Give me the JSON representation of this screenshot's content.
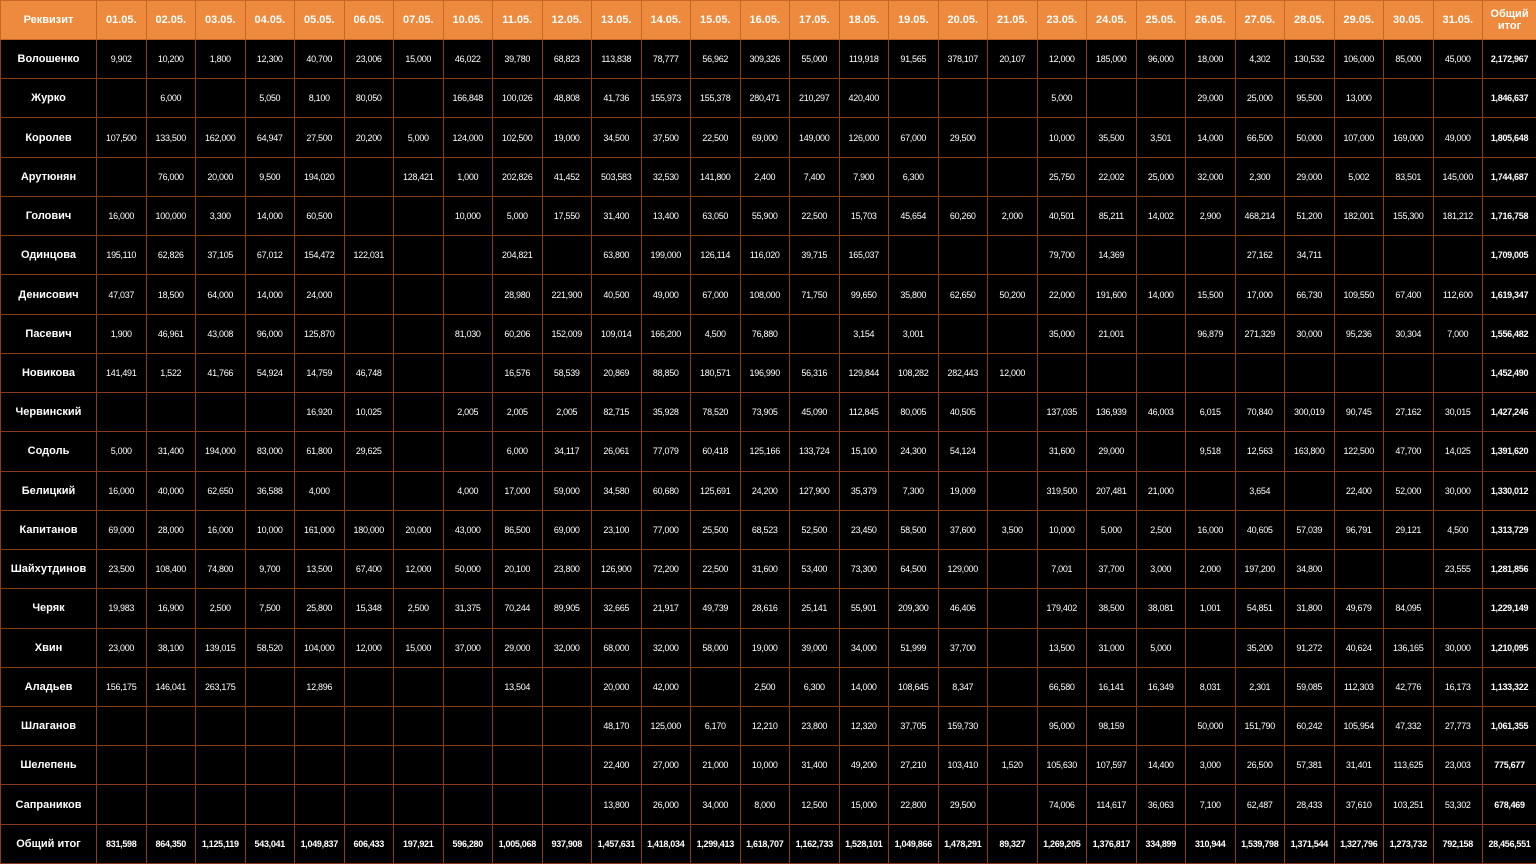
{
  "header": {
    "label": "Реквизит",
    "dates": [
      "01.05.",
      "02.05.",
      "03.05.",
      "04.05.",
      "05.05.",
      "06.05.",
      "07.05.",
      "10.05.",
      "11.05.",
      "12.05.",
      "13.05.",
      "14.05.",
      "15.05.",
      "16.05.",
      "17.05.",
      "18.05.",
      "19.05.",
      "20.05.",
      "21.05.",
      "23.05.",
      "24.05.",
      "25.05.",
      "26.05.",
      "27.05.",
      "28.05.",
      "29.05.",
      "30.05.",
      "31.05."
    ],
    "total": "Общий итог"
  },
  "rows": [
    {
      "name": "Волошенко",
      "values": [
        "9,902",
        "10,200",
        "1,800",
        "12,300",
        "40,700",
        "23,006",
        "15,000",
        "46,022",
        "39,780",
        "68,823",
        "113,838",
        "78,777",
        "56,962",
        "309,326",
        "55,000",
        "119,918",
        "91,565",
        "378,107",
        "20,107",
        "12,000",
        "185,000",
        "96,000",
        "18,000",
        "4,302",
        "130,532",
        "106,000",
        "85,000",
        "45,000"
      ],
      "total": "2,172,967"
    },
    {
      "name": "Журко",
      "values": [
        "",
        "6,000",
        "",
        "5,050",
        "8,100",
        "80,050",
        "",
        "166,848",
        "100,026",
        "48,808",
        "41,736",
        "155,973",
        "155,378",
        "280,471",
        "210,297",
        "420,400",
        "",
        "",
        "",
        "5,000",
        "",
        "",
        "29,000",
        "25,000",
        "95,500",
        "13,000",
        "",
        ""
      ],
      "total": "1,846,637"
    },
    {
      "name": "Королев",
      "values": [
        "107,500",
        "133,500",
        "162,000",
        "64,947",
        "27,500",
        "20,200",
        "5,000",
        "124,000",
        "102,500",
        "19,000",
        "34,500",
        "37,500",
        "22,500",
        "69,000",
        "149,000",
        "126,000",
        "67,000",
        "29,500",
        "",
        "10,000",
        "35,500",
        "3,501",
        "14,000",
        "66,500",
        "50,000",
        "107,000",
        "169,000",
        "49,000"
      ],
      "total": "1,805,648"
    },
    {
      "name": "Арутюнян",
      "values": [
        "",
        "76,000",
        "20,000",
        "9,500",
        "194,020",
        "",
        "128,421",
        "1,000",
        "202,826",
        "41,452",
        "503,583",
        "32,530",
        "141,800",
        "2,400",
        "7,400",
        "7,900",
        "6,300",
        "",
        "",
        "25,750",
        "22,002",
        "25,000",
        "32,000",
        "2,300",
        "29,000",
        "5,002",
        "83,501",
        "145,000"
      ],
      "total": "1,744,687"
    },
    {
      "name": "Голович",
      "values": [
        "16,000",
        "100,000",
        "3,300",
        "14,000",
        "60,500",
        "",
        "",
        "10,000",
        "5,000",
        "17,550",
        "31,400",
        "13,400",
        "63,050",
        "55,900",
        "22,500",
        "15,703",
        "45,654",
        "60,260",
        "2,000",
        "40,501",
        "85,211",
        "14,002",
        "2,900",
        "468,214",
        "51,200",
        "182,001",
        "155,300",
        "181,212"
      ],
      "total": "1,716,758"
    },
    {
      "name": "Одинцова",
      "values": [
        "195,110",
        "62,826",
        "37,105",
        "67,012",
        "154,472",
        "122,031",
        "",
        "",
        "204,821",
        "",
        "63,800",
        "199,000",
        "126,114",
        "116,020",
        "39,715",
        "165,037",
        "",
        "",
        "",
        "79,700",
        "14,369",
        "",
        "",
        "27,162",
        "34,711",
        "",
        "",
        ""
      ],
      "total": "1,709,005"
    },
    {
      "name": "Денисович",
      "values": [
        "47,037",
        "18,500",
        "64,000",
        "14,000",
        "24,000",
        "",
        "",
        "",
        "28,980",
        "221,900",
        "40,500",
        "49,000",
        "67,000",
        "108,000",
        "71,750",
        "99,650",
        "35,800",
        "62,650",
        "50,200",
        "22,000",
        "191,600",
        "14,000",
        "15,500",
        "17,000",
        "66,730",
        "109,550",
        "67,400",
        "112,600"
      ],
      "total": "1,619,347"
    },
    {
      "name": "Пасевич",
      "values": [
        "1,900",
        "46,961",
        "43,008",
        "96,000",
        "125,870",
        "",
        "",
        "81,030",
        "60,206",
        "152,009",
        "109,014",
        "166,200",
        "4,500",
        "76,880",
        "",
        "3,154",
        "3,001",
        "",
        "",
        "35,000",
        "21,001",
        "",
        "96,879",
        "271,329",
        "30,000",
        "95,236",
        "30,304",
        "7,000"
      ],
      "total": "1,556,482"
    },
    {
      "name": "Новикова",
      "values": [
        "141,491",
        "1,522",
        "41,766",
        "54,924",
        "14,759",
        "46,748",
        "",
        "",
        "16,576",
        "58,539",
        "20,869",
        "88,850",
        "180,571",
        "196,990",
        "56,316",
        "129,844",
        "108,282",
        "282,443",
        "12,000",
        "",
        "",
        "",
        "",
        "",
        "",
        "",
        "",
        ""
      ],
      "total": "1,452,490"
    },
    {
      "name": "Червинский",
      "values": [
        "",
        "",
        "",
        "",
        "16,920",
        "10,025",
        "",
        "2,005",
        "2,005",
        "2,005",
        "82,715",
        "35,928",
        "78,520",
        "73,905",
        "45,090",
        "112,845",
        "80,005",
        "40,505",
        "",
        "137,035",
        "136,939",
        "46,003",
        "6,015",
        "70,840",
        "300,019",
        "90,745",
        "27,162",
        "30,015"
      ],
      "total": "1,427,246"
    },
    {
      "name": "Содоль",
      "values": [
        "5,000",
        "31,400",
        "194,000",
        "83,000",
        "61,800",
        "29,625",
        "",
        "",
        "6,000",
        "34,117",
        "26,061",
        "77,079",
        "60,418",
        "125,166",
        "133,724",
        "15,100",
        "24,300",
        "54,124",
        "",
        "31,600",
        "29,000",
        "",
        "9,518",
        "12,563",
        "163,800",
        "122,500",
        "47,700",
        "14,025"
      ],
      "total": "1,391,620"
    },
    {
      "name": "Белицкий",
      "values": [
        "16,000",
        "40,000",
        "62,650",
        "36,588",
        "4,000",
        "",
        "",
        "4,000",
        "17,000",
        "59,000",
        "34,580",
        "60,680",
        "125,691",
        "24,200",
        "127,900",
        "35,379",
        "7,300",
        "19,009",
        "",
        "319,500",
        "207,481",
        "21,000",
        "",
        "3,654",
        "",
        "22,400",
        "52,000",
        "30,000"
      ],
      "total": "1,330,012"
    },
    {
      "name": "Капитанов",
      "values": [
        "69,000",
        "28,000",
        "16,000",
        "10,000",
        "161,000",
        "180,000",
        "20,000",
        "43,000",
        "86,500",
        "69,000",
        "23,100",
        "77,000",
        "25,500",
        "68,523",
        "52,500",
        "23,450",
        "58,500",
        "37,600",
        "3,500",
        "10,000",
        "5,000",
        "2,500",
        "16,000",
        "40,605",
        "57,039",
        "96,791",
        "29,121",
        "4,500"
      ],
      "total": "1,313,729"
    },
    {
      "name": "Шайхутдинов",
      "values": [
        "23,500",
        "108,400",
        "74,800",
        "9,700",
        "13,500",
        "67,400",
        "12,000",
        "50,000",
        "20,100",
        "23,800",
        "126,900",
        "72,200",
        "22,500",
        "31,600",
        "53,400",
        "73,300",
        "64,500",
        "129,000",
        "",
        "7,001",
        "37,700",
        "3,000",
        "2,000",
        "197,200",
        "34,800",
        "",
        "",
        "23,555"
      ],
      "total": "1,281,856"
    },
    {
      "name": "Черяк",
      "values": [
        "19,983",
        "16,900",
        "2,500",
        "7,500",
        "25,800",
        "15,348",
        "2,500",
        "31,375",
        "70,244",
        "89,905",
        "32,665",
        "21,917",
        "49,739",
        "28,616",
        "25,141",
        "55,901",
        "209,300",
        "46,406",
        "",
        "179,402",
        "38,500",
        "38,081",
        "1,001",
        "54,851",
        "31,800",
        "49,679",
        "84,095",
        ""
      ],
      "total": "1,229,149"
    },
    {
      "name": "Хвин",
      "values": [
        "23,000",
        "38,100",
        "139,015",
        "58,520",
        "104,000",
        "12,000",
        "15,000",
        "37,000",
        "29,000",
        "32,000",
        "68,000",
        "32,000",
        "58,000",
        "19,000",
        "39,000",
        "34,000",
        "51,999",
        "37,700",
        "",
        "13,500",
        "31,000",
        "5,000",
        "",
        "35,200",
        "91,272",
        "40,624",
        "136,165",
        "30,000"
      ],
      "total": "1,210,095"
    },
    {
      "name": "Аладьев",
      "values": [
        "156,175",
        "146,041",
        "263,175",
        "",
        "12,896",
        "",
        "",
        "",
        "13,504",
        "",
        "20,000",
        "42,000",
        "",
        "2,500",
        "6,300",
        "14,000",
        "108,645",
        "8,347",
        "",
        "66,580",
        "16,141",
        "16,349",
        "8,031",
        "2,301",
        "59,085",
        "112,303",
        "42,776",
        "16,173"
      ],
      "total": "1,133,322"
    },
    {
      "name": "Шлаганов",
      "values": [
        "",
        "",
        "",
        "",
        "",
        "",
        "",
        "",
        "",
        "",
        "48,170",
        "125,000",
        "6,170",
        "12,210",
        "23,800",
        "12,320",
        "37,705",
        "159,730",
        "",
        "95,000",
        "98,159",
        "",
        "50,000",
        "151,790",
        "60,242",
        "105,954",
        "47,332",
        "27,773"
      ],
      "total": "1,061,355"
    },
    {
      "name": "Шелепень",
      "values": [
        "",
        "",
        "",
        "",
        "",
        "",
        "",
        "",
        "",
        "",
        "22,400",
        "27,000",
        "21,000",
        "10,000",
        "31,400",
        "49,200",
        "27,210",
        "103,410",
        "1,520",
        "105,630",
        "107,597",
        "14,400",
        "3,000",
        "26,500",
        "57,381",
        "31,401",
        "113,625",
        "23,003"
      ],
      "total": "775,677"
    },
    {
      "name": "Сапраников",
      "values": [
        "",
        "",
        "",
        "",
        "",
        "",
        "",
        "",
        "",
        "",
        "13,800",
        "26,000",
        "34,000",
        "8,000",
        "12,500",
        "15,000",
        "22,800",
        "29,500",
        "",
        "74,006",
        "114,617",
        "36,063",
        "7,100",
        "62,487",
        "28,433",
        "37,610",
        "103,251",
        "53,302"
      ],
      "total": "678,469"
    }
  ],
  "grand_total": {
    "name": "Общий итог",
    "values": [
      "831,598",
      "864,350",
      "1,125,119",
      "543,041",
      "1,049,837",
      "606,433",
      "197,921",
      "596,280",
      "1,005,068",
      "937,908",
      "1,457,631",
      "1,418,034",
      "1,299,413",
      "1,618,707",
      "1,162,733",
      "1,528,101",
      "1,049,866",
      "1,478,291",
      "89,327",
      "1,269,205",
      "1,376,817",
      "334,899",
      "310,944",
      "1,539,798",
      "1,371,544",
      "1,327,796",
      "1,273,732",
      "792,158"
    ],
    "total": "28,456,551"
  }
}
